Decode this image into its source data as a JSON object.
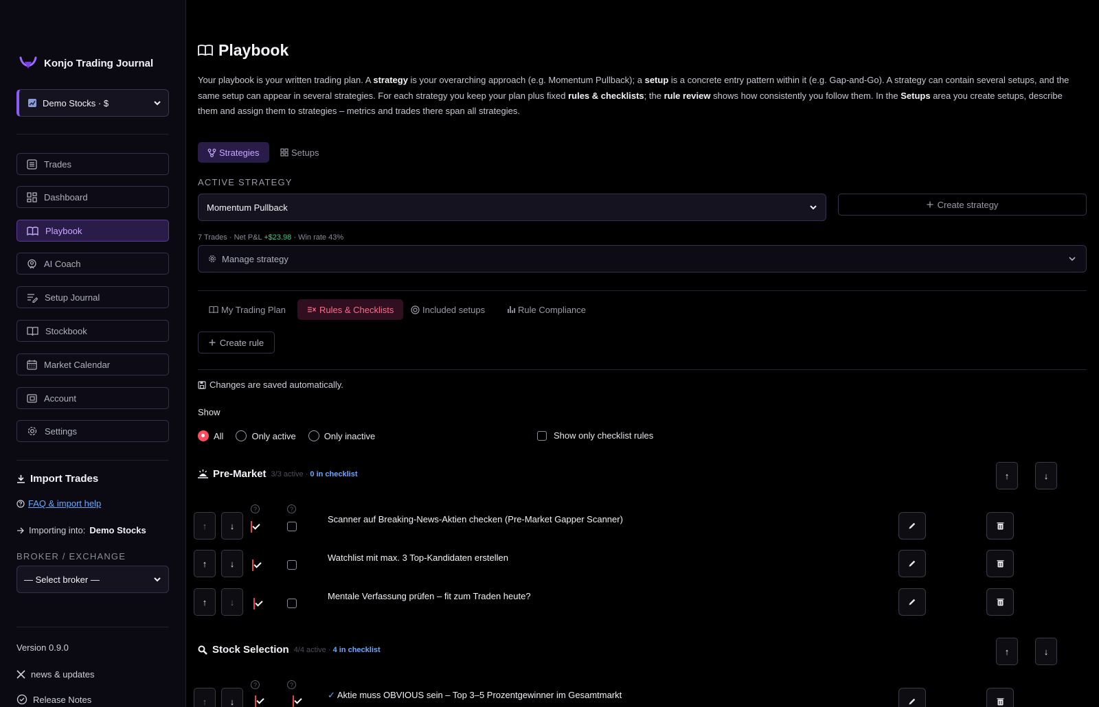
{
  "app": {
    "name": "Konjo Trading Journal",
    "account": "Demo Stocks · $",
    "version": "Version 0.9.0"
  },
  "sidebar": {
    "nav": [
      {
        "label": "Trades",
        "icon": "list-icon"
      },
      {
        "label": "Dashboard",
        "icon": "grid-icon"
      },
      {
        "label": "Playbook",
        "icon": "book-icon",
        "active": true
      },
      {
        "label": "AI Coach",
        "icon": "coach-icon"
      },
      {
        "label": "Setup Journal",
        "icon": "journal-icon"
      },
      {
        "label": "Stockbook",
        "icon": "stockbook-icon"
      },
      {
        "label": "Market Calendar",
        "icon": "calendar-icon"
      },
      {
        "label": "Account",
        "icon": "wallet-icon"
      },
      {
        "label": "Settings",
        "icon": "gear-icon"
      }
    ],
    "import_title": "Import Trades",
    "faq_link": "FAQ & import help",
    "importing_into_label": "Importing into:",
    "importing_into_value": "Demo Stocks",
    "broker_label": "BROKER / EXCHANGE",
    "broker_placeholder": "— Select broker —",
    "news_link": "news & updates",
    "release_notes": "Release Notes"
  },
  "page": {
    "title": "Playbook",
    "intro": {
      "p1": "Your playbook is your written trading plan. A ",
      "b1": "strategy",
      "p2": " is your overarching approach (e.g. Momentum Pullback); a ",
      "b2": "setup",
      "p3": " is a concrete entry pattern within it (e.g. Gap-and-Go). A strategy can contain several setups, and the same setup can appear in several strategies. For each strategy you keep your plan plus fixed ",
      "b3": "rules & checklists",
      "p4": "; the ",
      "b4": "rule review",
      "p5": " shows how consistently you follow them. In the ",
      "b5": "Setups",
      "p6": " area you create setups, describe them and assign them to strategies – metrics and trades there span all strategies."
    },
    "top_tabs": [
      {
        "label": "Strategies",
        "active": true
      },
      {
        "label": "Setups"
      }
    ],
    "active_strategy_label": "ACTIVE STRATEGY",
    "active_strategy": "Momentum Pullback",
    "create_strategy": "Create strategy",
    "stats": {
      "trades": "7 Trades",
      "pnl_label": "Net P&L",
      "pnl_value": "+$23.98",
      "win_rate": "Win rate 43%"
    },
    "manage_strategy": "Manage strategy",
    "sub_tabs": [
      {
        "label": "My Trading Plan"
      },
      {
        "label": "Rules & Checklists",
        "active": true
      },
      {
        "label": "Included setups"
      },
      {
        "label": "Rule Compliance"
      }
    ],
    "create_rule": "Create rule",
    "saved_note": "Changes are saved automatically.",
    "show_label": "Show",
    "filters": {
      "all": "All",
      "only_active": "Only active",
      "only_inactive": "Only inactive",
      "selected": "All",
      "checklist_only": "Show only checklist rules"
    },
    "groups": [
      {
        "title": "Pre-Market",
        "icon": "sunrise-icon",
        "active": "3/3 active",
        "checklist": "0 in checklist",
        "rules": [
          {
            "text": "Scanner auf Breaking-News-Aktien checken (Pre-Market Gapper Scanner)",
            "active": true,
            "checklist": false
          },
          {
            "text": "Watchlist mit max. 3 Top-Kandidaten erstellen",
            "active": true,
            "checklist": false
          },
          {
            "text": "Mentale Verfassung prüfen – fit zum Traden heute?",
            "active": true,
            "checklist": false
          }
        ]
      },
      {
        "title": "Stock Selection",
        "icon": "magnifier-icon",
        "active": "4/4 active",
        "checklist": "4 in checklist",
        "rules": [
          {
            "text": "Aktie muss OBVIOUS sein – Top 3–5 Prozentgewinner im Gesamtmarkt",
            "prefix": "✓",
            "active": true,
            "checklist": true
          }
        ]
      }
    ]
  },
  "colors": {
    "accent": "#8b5cf6",
    "checkbox_on": "#ef4444",
    "link": "#6aa8ff",
    "positive": "#3ad07a"
  }
}
